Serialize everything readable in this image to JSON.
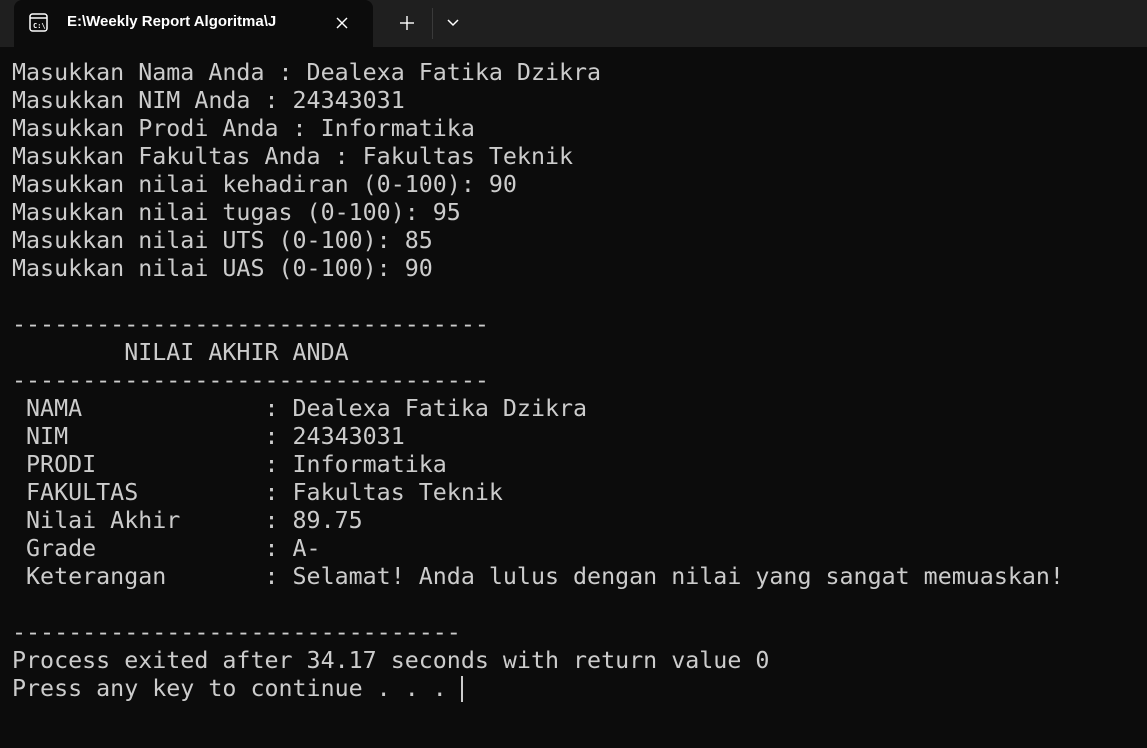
{
  "titlebar": {
    "tab_title": "E:\\Weekly Report Algoritma\\J",
    "tab_icon": "terminal-icon",
    "close_icon": "close-icon",
    "new_tab_icon": "plus-icon",
    "dropdown_icon": "chevron-down-icon"
  },
  "console": {
    "lines": [
      "Masukkan Nama Anda : Dealexa Fatika Dzikra",
      "Masukkan NIM Anda : 24343031",
      "Masukkan Prodi Anda : Informatika",
      "Masukkan Fakultas Anda : Fakultas Teknik",
      "Masukkan nilai kehadiran (0-100): 90",
      "Masukkan nilai tugas (0-100): 95",
      "Masukkan nilai UTS (0-100): 85",
      "Masukkan nilai UAS (0-100): 90",
      "",
      "----------------------------------",
      "        NILAI AKHIR ANDA",
      "----------------------------------",
      " NAMA             : Dealexa Fatika Dzikra",
      " NIM              : 24343031",
      " PRODI            : Informatika",
      " FAKULTAS         : Fakultas Teknik",
      " Nilai Akhir      : 89.75",
      " Grade            : A-",
      " Keterangan       : Selamat! Anda lulus dengan nilai yang sangat memuaskan!",
      "",
      "--------------------------------",
      "Process exited after 34.17 seconds with return value 0",
      "Press any key to continue . . . "
    ]
  }
}
